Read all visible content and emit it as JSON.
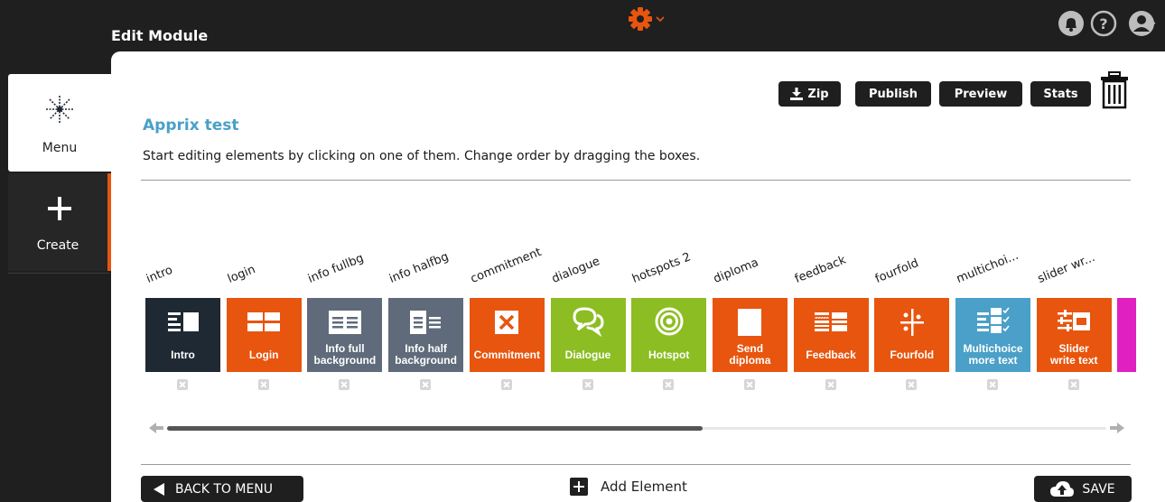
{
  "header": {
    "title": "Edit Module",
    "settings_icon": "gear-icon",
    "icons": [
      "bell-icon",
      "help-icon",
      "user-avatar-icon"
    ],
    "accent_color": "#e8550e"
  },
  "sidebar": {
    "items": [
      {
        "label": "Menu",
        "icon": "snowflake-icon",
        "active": true
      },
      {
        "label": "Create",
        "icon": "plus-icon",
        "active": false
      }
    ]
  },
  "toolbar": {
    "zip_label": "Zip",
    "publish_label": "Publish",
    "preview_label": "Preview",
    "stats_label": "Stats"
  },
  "module": {
    "name": "Apprix test",
    "instructions": "Start editing elements by clicking on one of them. Change order by dragging the boxes."
  },
  "elements": [
    {
      "name": "intro",
      "caption": [
        "Intro"
      ],
      "color": "#1f2933",
      "icon": "intro-icon"
    },
    {
      "name": "login",
      "caption": [
        "Login"
      ],
      "color": "#e8550e",
      "icon": "login-icon"
    },
    {
      "name": "info fullbg",
      "caption": [
        "Info full",
        "background"
      ],
      "color": "#5f6b7a",
      "icon": "info-full-icon"
    },
    {
      "name": "info halfbg",
      "caption": [
        "Info half",
        "background"
      ],
      "color": "#5f6b7a",
      "icon": "info-half-icon"
    },
    {
      "name": "commitment",
      "caption": [
        "Commitment"
      ],
      "color": "#e8550e",
      "icon": "commitment-icon"
    },
    {
      "name": "dialogue",
      "caption": [
        "Dialogue"
      ],
      "color": "#8cbd22",
      "icon": "chat-bubbles-icon"
    },
    {
      "name": "hotspots 2",
      "caption": [
        "Hotspot"
      ],
      "color": "#8cbd22",
      "icon": "target-icon"
    },
    {
      "name": "diploma",
      "caption": [
        "Send",
        "diploma"
      ],
      "color": "#e8550e",
      "icon": "diploma-icon"
    },
    {
      "name": "feedback",
      "caption": [
        "Feedback"
      ],
      "color": "#e8550e",
      "icon": "feedback-icon"
    },
    {
      "name": "fourfold",
      "caption": [
        "Fourfold"
      ],
      "color": "#e8550e",
      "icon": "fourfold-icon"
    },
    {
      "name": "multichoi...",
      "caption": [
        "Multichoice",
        "more text"
      ],
      "color": "#4aa0c8",
      "icon": "checklist-icon"
    },
    {
      "name": "slider wr...",
      "caption": [
        "Slider",
        "write text"
      ],
      "color": "#e8550e",
      "icon": "slider-icon"
    },
    {
      "name": "",
      "caption": [
        ""
      ],
      "color": "#e020c0",
      "icon": ""
    }
  ],
  "scroll": {
    "position": 0.57
  },
  "footer": {
    "back_label": "BACK TO MENU",
    "add_label": "Add Element",
    "save_label": "SAVE"
  }
}
